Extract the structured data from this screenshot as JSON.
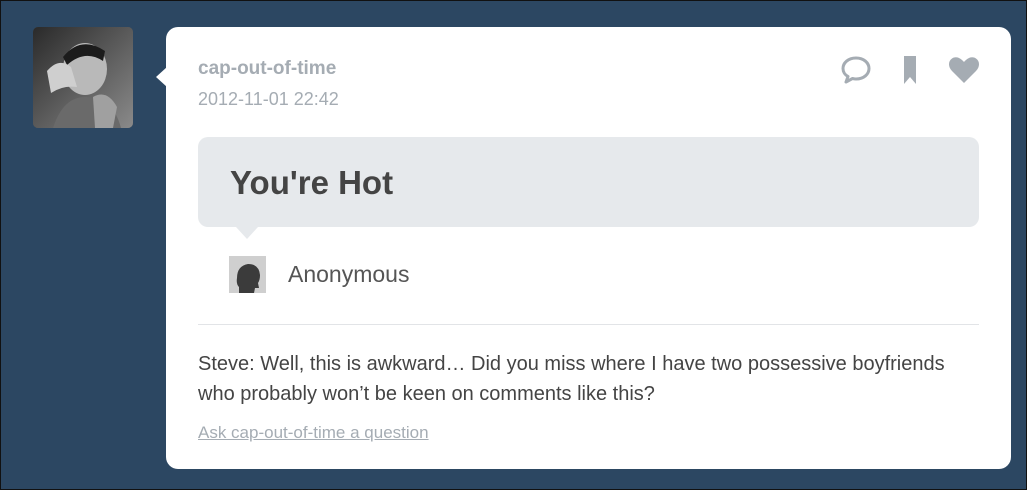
{
  "post": {
    "blog_name": "cap-out-of-time",
    "date": "2012-11-01 22:42",
    "question": "You're Hot",
    "asker_name": "Anonymous",
    "answer": "Steve: Well, this is awkward… Did you miss where I have two possessive boyfriends who probably won’t be keen on comments like this?",
    "ask_link": "Ask cap-out-of-time a question"
  },
  "actions": [
    {
      "name": "reply",
      "icon": "speech-bubble-icon"
    },
    {
      "name": "bookmark",
      "icon": "bookmark-icon"
    },
    {
      "name": "like",
      "icon": "heart-icon"
    }
  ],
  "colors": {
    "background": "#2c4762",
    "card": "#ffffff",
    "meta_text": "#a5acb3",
    "question_bubble": "#e6e9ec",
    "body_text": "#444444"
  }
}
